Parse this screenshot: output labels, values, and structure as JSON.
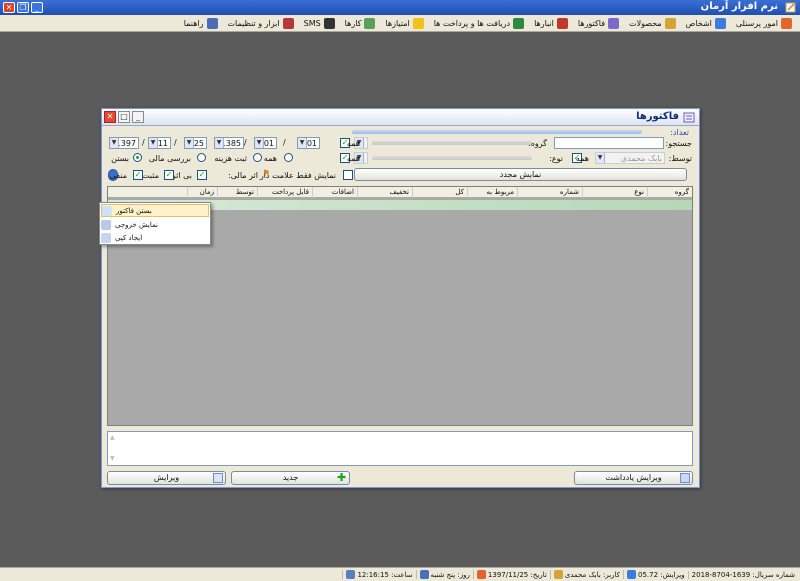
{
  "app": {
    "title": "نرم افزار آرمان",
    "icon": "pencil-note-icon",
    "window_controls": [
      "close",
      "minimize",
      "restore"
    ]
  },
  "menubar": {
    "items": [
      {
        "label": "امور پرسنلی",
        "icon": "people-icon",
        "color": "#e0662b"
      },
      {
        "label": "اشخاص",
        "icon": "persons-icon",
        "color": "#3c7be0"
      },
      {
        "label": "محصولات",
        "icon": "box-icon",
        "color": "#d4a437"
      },
      {
        "label": "فاکتورها",
        "icon": "invoice-icon",
        "color": "#7c6ac9"
      },
      {
        "label": "انبارها",
        "icon": "warehouse-icon",
        "color": "#c0392b"
      },
      {
        "label": "دریافت ها و پرداخت ها",
        "icon": "money-icon",
        "color": "#2d8a3e"
      },
      {
        "label": "امتیازها",
        "icon": "star-icon",
        "color": "#f2c21b"
      },
      {
        "label": "کارها",
        "icon": "tasks-icon",
        "color": "#5aa05a"
      },
      {
        "label": "SMS",
        "icon": "sms-icon",
        "color": "#333333"
      },
      {
        "label": "ابزار و تنظیمات",
        "icon": "tools-icon",
        "color": "#b33a3a"
      },
      {
        "label": "راهنما",
        "icon": "help-icon",
        "color": "#4a6fb5"
      }
    ]
  },
  "dialog": {
    "title": "فاکتورها",
    "count_label": "تعداد:",
    "count_value": "",
    "search_label": "جستجو:",
    "search_value": "",
    "group_label": "گروه:",
    "group_value": "",
    "group_all_checked": true,
    "all_label": "همه",
    "by_label": "توسط:",
    "by_value": "بابک محمدی",
    "by_all_checked": true,
    "type_label": "نوع:",
    "type_all_checked": true,
    "date_from_label": "از",
    "date_to_label": "تا",
    "date_from": {
      "year": "1385",
      "month": "01",
      "day": "01"
    },
    "date_to": {
      "year": "1397",
      "month": "11",
      "day": "25"
    },
    "radios": {
      "row1": [
        {
          "label": "بستن",
          "selected": true
        },
        {
          "label": "بررسی مالی",
          "selected": false
        },
        {
          "label": "ثبت هزینه",
          "selected": false
        },
        {
          "label": "همه",
          "selected": false
        }
      ]
    },
    "refresh_button": "نمایش مجدد",
    "mark_only_label": "نمایش فقط علامت دار",
    "mark_only_checked": false,
    "financial_effect_label": "اثر مالی:",
    "effect_options": [
      {
        "label": "بی اثر",
        "checked": true
      },
      {
        "label": "مثبت",
        "checked": true
      },
      {
        "label": "منفی",
        "checked": true
      }
    ],
    "grid": {
      "columns": [
        "گروه",
        "نوع",
        "شماره",
        "مربوط به",
        "کل",
        "تخفیف",
        "اضافات",
        "قابل پرداخت",
        "توسط",
        "زمان"
      ]
    },
    "context_menu": [
      {
        "label": "بستن فاکتور",
        "icon": "close-invoice-icon",
        "highlighted": true
      },
      {
        "label": "نمایش خروجی",
        "icon": "print-icon",
        "highlighted": false
      },
      {
        "label": "ایجاد کپی",
        "icon": "copy-icon",
        "highlighted": false
      }
    ],
    "notes_value": "",
    "buttons": {
      "edit_note": "ویرایش یادداشت",
      "new": "جدید",
      "edit": "ویرایش"
    }
  },
  "statusbar": {
    "serial": "شماره سریال: 1639-8704-2018",
    "version": "ویرایش: 05.72",
    "user": "کاربر: بابک محمدی",
    "date": "تاریخ: 1397/11/25",
    "day": "روز: پنج شنبه",
    "time": "ساعت: 12:16:15"
  }
}
